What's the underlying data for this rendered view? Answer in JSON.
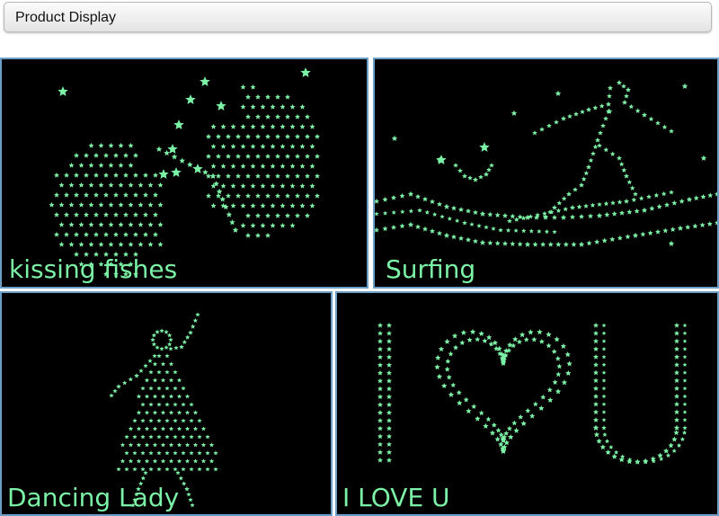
{
  "header": {
    "title": "Product Display"
  },
  "colors": {
    "glow": "#7cf2a6",
    "border": "#6a9ec6",
    "background": "#000000"
  },
  "panels": [
    {
      "caption": "kissing fishes",
      "icon": "kissing-fishes-star-pattern"
    },
    {
      "caption": "Surfing",
      "icon": "surfer-star-pattern"
    },
    {
      "caption": "Dancing Lady",
      "icon": "dancing-lady-star-pattern"
    },
    {
      "caption": "I LOVE U",
      "icon": "i-love-u-star-pattern"
    }
  ]
}
